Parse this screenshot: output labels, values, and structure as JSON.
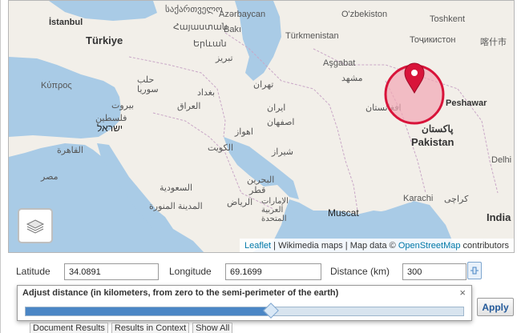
{
  "map": {
    "labels": {
      "istanbul": "İstanbul",
      "turkiye": "Türkiye",
      "georgia": "საქართველო",
      "armenia": "Հայաստան",
      "yerevan": "Երևան",
      "azerbaijan": "Azərbaycan",
      "baku": "Bakı",
      "uzbekistan": "O'zbekiston",
      "toshkent": "Toshkent",
      "tajikistan": "Тоҷикистон",
      "turkmenistan": "Türkmenistan",
      "ashgabat": "Aşgabat",
      "kashgar": "喀什市",
      "kibris": "Κύπρος",
      "syria": "سوريا",
      "halab": "حلب",
      "beirut": "بيروت",
      "israel": "ישראל",
      "palestine": "فلسطين",
      "tabriz": "تبریز",
      "tehran": "تهران",
      "iran": "ایران",
      "iraq": "العراق",
      "baghdad": "بغداد",
      "isfahan": "اصفهان",
      "ahvaz": "اهواز",
      "kuwait": "الكويت",
      "shiraz": "شیراز",
      "mashhad": "مشهد",
      "afghanistan": "افغانستان",
      "peshawar": "Peshawar",
      "pakistan_ur": "پاکستان",
      "pakistan": "Pakistan",
      "cairo": "القاهرة",
      "egypt": "مصر",
      "saudi": "السعودية",
      "riyadh": "الرياض",
      "medina": "المدينة المنورة",
      "bahrain": "البحرين",
      "qatar": "قطر",
      "uae": "الإمارات العربية المتحدة",
      "muscat": "Muscat",
      "karachi": "Karachi",
      "karachi_ur": "کراچی",
      "delhi": "Delhi",
      "india": "India"
    },
    "attribution": {
      "leaflet": "Leaflet",
      "sep": " | ",
      "wikimedia": "Wikimedia maps",
      "mapdata": " | Map data © ",
      "osm": "OpenStreetMap",
      "contributors": " contributors"
    }
  },
  "form": {
    "latitude_label": "Latitude",
    "latitude_value": "34.0891",
    "longitude_label": "Longitude",
    "longitude_value": "69.1699",
    "distance_label": "Distance (km)",
    "distance_value": "300"
  },
  "popup": {
    "title": "Adjust distance (in kilometers, from zero to the semi-perimeter of the earth)",
    "close": "×",
    "slider_fraction": 0.56
  },
  "apply_label": "Apply",
  "tabs": [
    "Document Results",
    "Results in Context",
    "Show All"
  ],
  "colors": {
    "circle_fill": "#f2a6b4",
    "circle_stroke": "#d8143a",
    "marker": "#d8143a",
    "slider_fill": "#4a86c5",
    "water": "#a9cbe6",
    "land": "#f2efe9"
  }
}
